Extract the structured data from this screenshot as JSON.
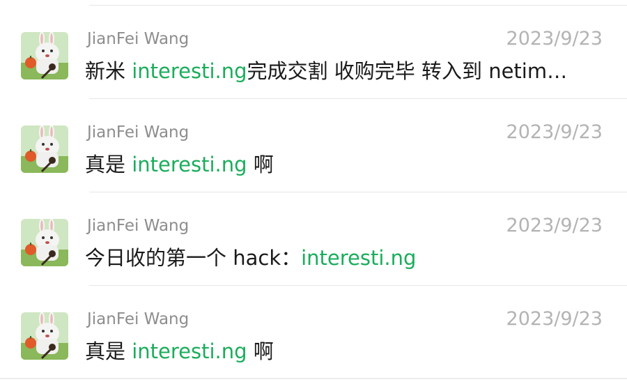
{
  "accent_link_color": "#1aad5b",
  "messages": [
    {
      "sender": "JianFei Wang",
      "date": "2023/9/23",
      "avatar_icon": "bunny-avatar-icon",
      "text_before": "新米 ",
      "link": "interesti.ng",
      "text_after": "完成交割 收购完毕 转入到 netim…"
    },
    {
      "sender": "JianFei Wang",
      "date": "2023/9/23",
      "avatar_icon": "bunny-avatar-icon",
      "text_before": "真是 ",
      "link": "interesti.ng",
      "text_after": " 啊"
    },
    {
      "sender": "JianFei Wang",
      "date": "2023/9/23",
      "avatar_icon": "bunny-avatar-icon",
      "text_before": "今日收的第一个 hack：",
      "link": "interesti.ng",
      "text_after": ""
    },
    {
      "sender": "JianFei Wang",
      "date": "2023/9/23",
      "avatar_icon": "bunny-avatar-icon",
      "text_before": "真是 ",
      "link": "interesti.ng",
      "text_after": " 啊"
    }
  ]
}
